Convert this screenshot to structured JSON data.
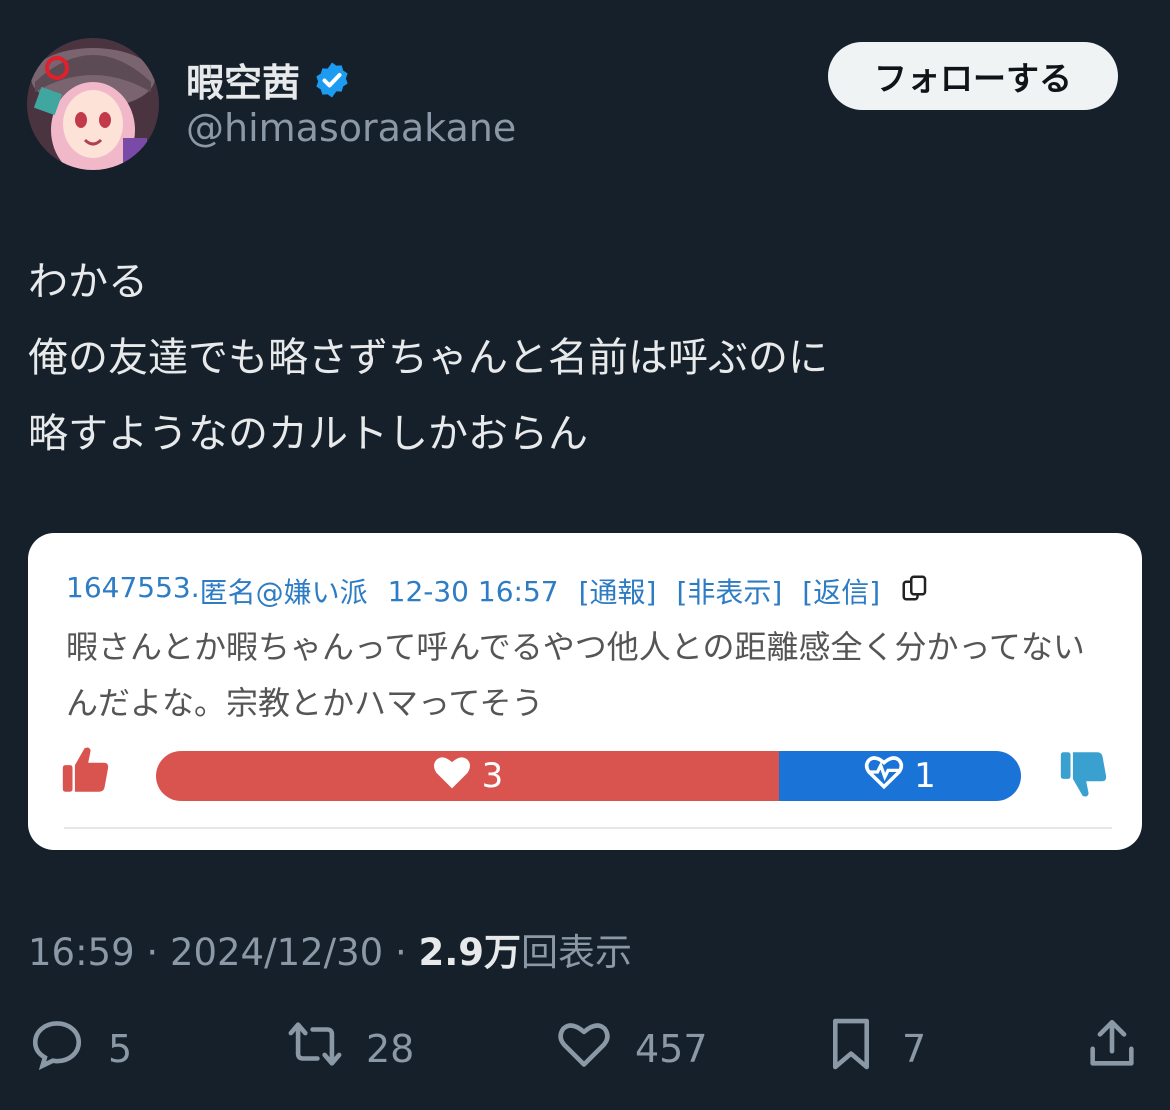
{
  "author": {
    "display_name": "暇空茜",
    "handle": "@himasoraakane",
    "verified": true
  },
  "follow_button": {
    "label": "フォローする"
  },
  "tweet": {
    "lines": [
      "わかる",
      "俺の友達でも略さずちゃんと名前は呼ぶのに",
      "略すようなのカルトしかおらん"
    ]
  },
  "quoted_card": {
    "post_number": "1647553.",
    "author": "匿名@嫌い派",
    "timestamp": "12-30 16:57",
    "links": [
      "[通報]",
      "[非表示]",
      "[返信]"
    ],
    "body": "暇さんとか暇ちゃんって呼んでるやつ他人との距離感全く分かってないんだよな。宗教とかハマってそう",
    "good_count": "3",
    "bad_count": "1",
    "good_fraction": 0.72
  },
  "meta": {
    "time": "16:59",
    "date": "2024/12/30",
    "separator": "·",
    "views_number": "2.9",
    "views_unit": "万",
    "views_label": "回表示"
  },
  "actions": {
    "replies": "5",
    "retweets": "28",
    "likes": "457",
    "bookmarks": "7"
  },
  "colors": {
    "background": "#15202b",
    "verified_blue": "#1d9bf0",
    "good_red": "#d9534f",
    "bad_blue": "#1a73d6"
  }
}
